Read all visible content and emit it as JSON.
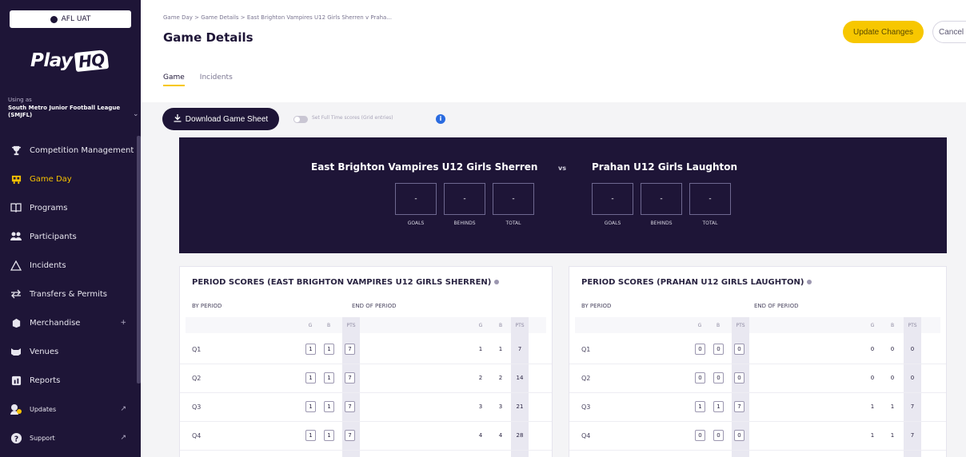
{
  "sidebar": {
    "env_label": "AFL UAT",
    "logo_text": "Play",
    "logo_badge": "HQ",
    "using_as_label": "Using as",
    "org_name": "South Metro Junior Football League (SMJFL)",
    "items": [
      {
        "label": "Competition Management",
        "icon": "trophy-icon",
        "active": false
      },
      {
        "label": "Game Day",
        "icon": "scoreboard-icon",
        "active": true
      },
      {
        "label": "Programs",
        "icon": "book-icon",
        "active": false
      },
      {
        "label": "Participants",
        "icon": "people-icon",
        "active": false
      },
      {
        "label": "Incidents",
        "icon": "warning-icon",
        "active": false
      },
      {
        "label": "Transfers & Permits",
        "icon": "arrows-icon",
        "active": false
      },
      {
        "label": "Merchandise",
        "icon": "merch-icon",
        "active": false,
        "suffix": "+"
      },
      {
        "label": "Venues",
        "icon": "stadium-icon",
        "active": false
      },
      {
        "label": "Reports",
        "icon": "report-icon",
        "active": false
      },
      {
        "label": "Updates",
        "icon": "updates-icon",
        "active": false
      },
      {
        "label": "Support",
        "icon": "help-icon",
        "active": false
      }
    ]
  },
  "header": {
    "breadcrumb": "Game Day  >  Game Details  >  East Brighton Vampires U12 Girls Sherren v Praha...",
    "title": "Game Details",
    "update_label": "Update Changes",
    "cancel_label": "Cancel",
    "tabs": [
      {
        "label": "Game",
        "active": true
      },
      {
        "label": "Incidents",
        "active": false
      }
    ]
  },
  "toolbar": {
    "download_label": "Download Game Sheet",
    "toggle_label": "Set Full Time scores (Grid entries)"
  },
  "banner": {
    "home_team": "East Brighton Vampires U12 Girls Sherren",
    "vs": "vs",
    "away_team": "Prahan U12 Girls Laughton",
    "home_scores": {
      "goals": "-",
      "behinds": "-",
      "total": "-"
    },
    "away_scores": {
      "goals": "-",
      "behinds": "-",
      "total": "-"
    },
    "labels": {
      "goals": "GOALS",
      "behinds": "BEHINDS",
      "total": "TOTAL"
    }
  },
  "period_scores": {
    "home": {
      "title": "PERIOD SCORES (EAST BRIGHTON VAMPIRES U12 GIRLS SHERREN)",
      "by_period_label": "BY PERIOD",
      "end_period_label": "END OF PERIOD",
      "col_g": "G",
      "col_b": "B",
      "col_pts": "PTS",
      "rows": [
        {
          "label": "Q1",
          "g": "1",
          "b": "1",
          "pts": "7",
          "end_g": "1",
          "end_b": "1",
          "end_pts": "7"
        },
        {
          "label": "Q2",
          "g": "1",
          "b": "1",
          "pts": "7",
          "end_g": "2",
          "end_b": "2",
          "end_pts": "14"
        },
        {
          "label": "Q3",
          "g": "1",
          "b": "1",
          "pts": "7",
          "end_g": "3",
          "end_b": "3",
          "end_pts": "21"
        },
        {
          "label": "Q4",
          "g": "1",
          "b": "1",
          "pts": "7",
          "end_g": "4",
          "end_b": "4",
          "end_pts": "28"
        }
      ]
    },
    "away": {
      "title": "PERIOD SCORES (PRAHAN U12 GIRLS LAUGHTON)",
      "by_period_label": "BY PERIOD",
      "end_period_label": "END OF PERIOD",
      "col_g": "G",
      "col_b": "B",
      "col_pts": "PTS",
      "rows": [
        {
          "label": "Q1",
          "g": "0",
          "b": "0",
          "pts": "0",
          "end_g": "0",
          "end_b": "0",
          "end_pts": "0"
        },
        {
          "label": "Q2",
          "g": "0",
          "b": "0",
          "pts": "0",
          "end_g": "0",
          "end_b": "0",
          "end_pts": "0"
        },
        {
          "label": "Q3",
          "g": "1",
          "b": "1",
          "pts": "7",
          "end_g": "1",
          "end_b": "1",
          "end_pts": "7"
        },
        {
          "label": "Q4",
          "g": "0",
          "b": "0",
          "pts": "0",
          "end_g": "1",
          "end_b": "1",
          "end_pts": "7"
        }
      ]
    }
  },
  "colors": {
    "brand_dark": "#1e1537",
    "accent": "#f7c700",
    "info": "#2a6be0"
  }
}
